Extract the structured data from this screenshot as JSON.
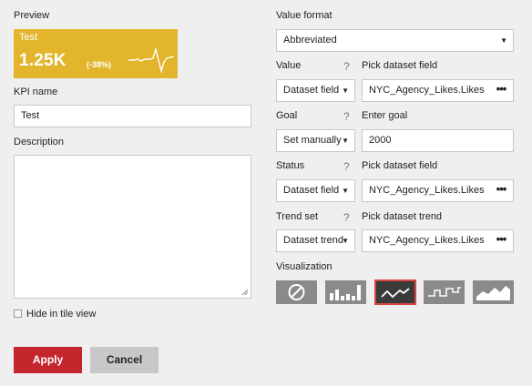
{
  "preview": {
    "label": "Preview",
    "tile_title": "Test",
    "tile_value": "1.25K",
    "tile_change": "(-38%)",
    "tile_color": "#e2b52c"
  },
  "kpi_name": {
    "label": "KPI name",
    "value": "Test"
  },
  "description": {
    "label": "Description",
    "value": ""
  },
  "hide_in_tile": {
    "label": "Hide in tile view",
    "checked": false
  },
  "value_format": {
    "label": "Value format",
    "selected": "Abbreviated"
  },
  "value_row": {
    "label": "Value",
    "help": "?",
    "field_label": "Pick dataset field",
    "select": "Dataset field",
    "field": "NYC_Agency_Likes.Likes",
    "more": "•••"
  },
  "goal_row": {
    "label": "Goal",
    "help": "?",
    "field_label": "Enter goal",
    "select": "Set manually",
    "field": "2000"
  },
  "status_row": {
    "label": "Status",
    "help": "?",
    "field_label": "Pick dataset field",
    "select": "Dataset field",
    "field": "NYC_Agency_Likes.Likes",
    "more": "•••"
  },
  "trend_row": {
    "label": "Trend set",
    "help": "?",
    "field_label": "Pick dataset trend",
    "select": "Dataset trend",
    "field": "NYC_Agency_Likes.Likes",
    "more": "•••"
  },
  "visualization": {
    "label": "Visualization",
    "options": [
      "none-icon",
      "bar-chart-icon",
      "line-chart-icon",
      "step-chart-icon",
      "area-chart-icon"
    ],
    "selected": "line-chart-icon",
    "accent": "#d64541"
  },
  "buttons": {
    "apply": "Apply",
    "cancel": "Cancel",
    "apply_color": "#c4262e"
  }
}
